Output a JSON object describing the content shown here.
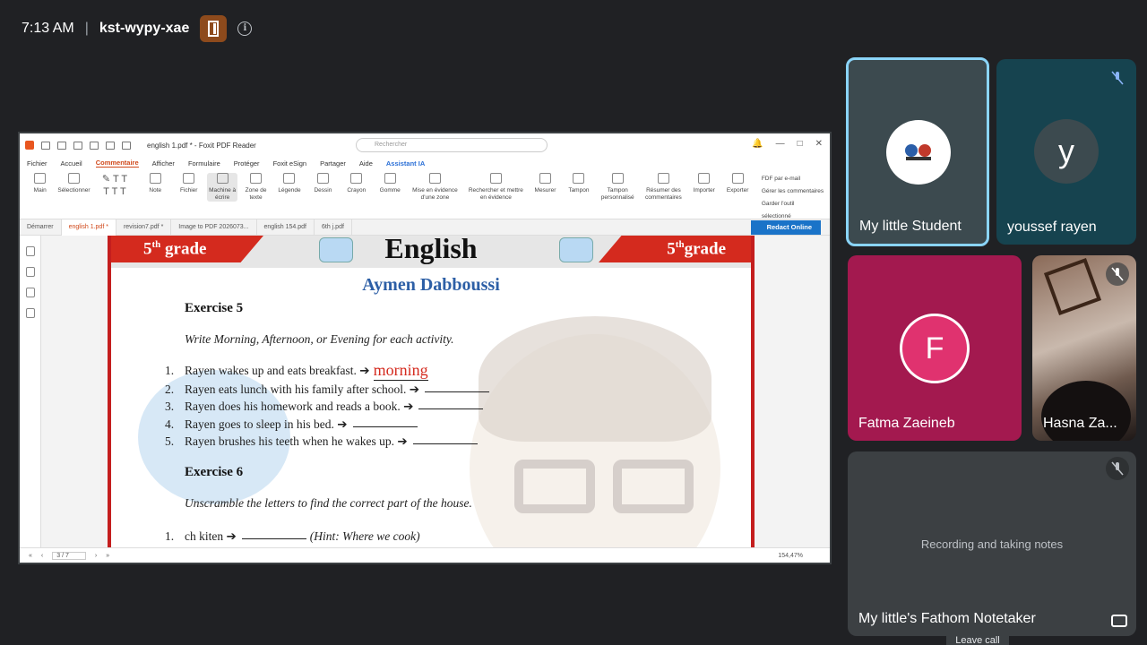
{
  "meeting": {
    "time": "7:13 AM",
    "separator": "|",
    "code": "kst-wypy-xae"
  },
  "pdf": {
    "window_title": "english 1.pdf * - Foxit PDF Reader",
    "search_placeholder": "Rechercher",
    "menu": [
      "Fichier",
      "Accueil",
      "Commentaire",
      "Afficher",
      "Formulaire",
      "Protéger",
      "Foxit eSign",
      "Partager",
      "Aide",
      "Assistant IA"
    ],
    "ribbon": [
      "Main",
      "Sélectionner",
      "Note",
      "Fichier",
      "Machine à écrire",
      "Zone de texte",
      "Légende",
      "Dessin",
      "Crayon",
      "Gomme",
      "Mise en évidence d'une zone",
      "Rechercher et mettre en évidence",
      "Mesurer",
      "Tampon",
      "Tampon personnalisé",
      "Résumer des commentaires",
      "Importer",
      "Exporter"
    ],
    "ribbon_side": [
      "FDF par e-mail",
      "Gérer les commentaires",
      "Garder l'outil sélectionné"
    ],
    "tabs": [
      "Démarrer",
      "english 1.pdf *",
      "revision7.pdf *",
      "Image to PDF 2026073...",
      "english 154.pdf",
      "6th j.pdf"
    ],
    "redact_button": "Redact Online",
    "page_indicator": "3 / 7",
    "zoom": "154,47%",
    "doc": {
      "grade_left": "5",
      "grade_left_sup": "th",
      "grade_left_word": " grade",
      "grade_right": "5",
      "grade_right_sup": "th",
      "grade_right_word": "grade",
      "subject": "English",
      "author": "Aymen Dabboussi",
      "ex5_title": "Exercise 5",
      "ex5_instr": "Write Morning, Afternoon, or Evening for each activity.",
      "ex5_items": [
        "Rayen wakes up and eats breakfast. ➔",
        "Rayen eats lunch with his family after school. ➔",
        "Rayen does his homework and reads a book. ➔",
        "Rayen goes to sleep in his bed. ➔",
        "Rayen brushes his teeth when he wakes up. ➔"
      ],
      "ex5_answer1": "morning",
      "ex6_title": "Exercise 6",
      "ex6_instr": "Unscramble the letters to find the correct part of the house.",
      "ex6_item1": "ch kiten ➔",
      "ex6_hint": "(Hint: Where we cook)"
    }
  },
  "participants": [
    {
      "name": "My little Student",
      "avatar_text": "",
      "muted": false,
      "color": "#3c4a4f"
    },
    {
      "name": "youssef rayen",
      "avatar_text": "y",
      "muted": true,
      "color": "#16434f"
    },
    {
      "name": "Fatma Zaeineb",
      "avatar_text": "F",
      "muted": false,
      "color": "#a3194f"
    },
    {
      "name": "Hasna Za...",
      "avatar_text": "",
      "muted": true,
      "color": "#5b3a2c"
    },
    {
      "name": "My little's Fathom Notetaker",
      "avatar_text": "",
      "muted": true,
      "color": "#3c4043",
      "status": "Recording and taking notes"
    }
  ],
  "leave_tooltip": "Leave call"
}
